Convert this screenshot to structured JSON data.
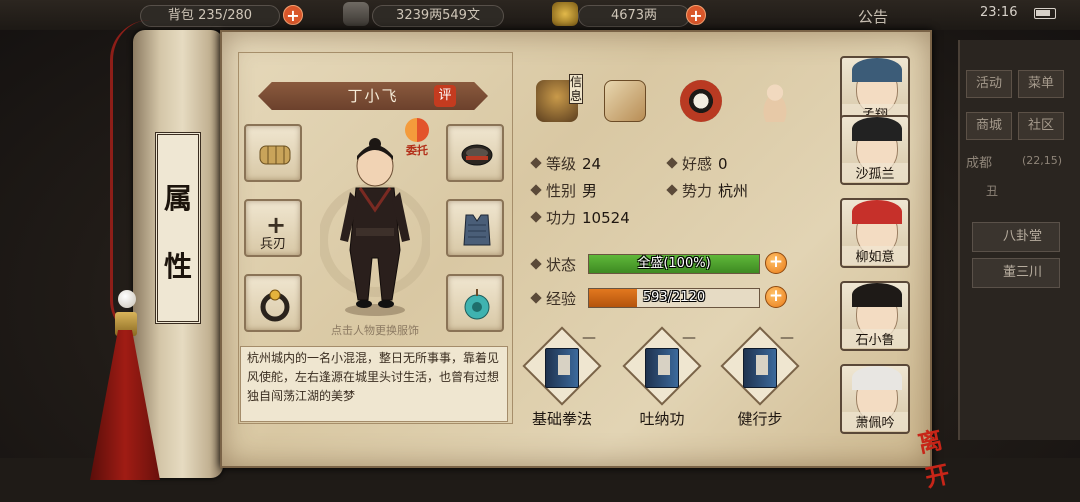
{
  "topbar": {
    "bag_label": "背包",
    "bag_value": "235/280",
    "money_value": "3239两549文",
    "gold_value": "4673两",
    "notice_label": "公告",
    "clock": "23:16"
  },
  "background_menu": {
    "buttons": [
      "活动",
      "菜单",
      "商城",
      "社区"
    ],
    "location": "成都",
    "coords": "(22,15)",
    "time_of_day": "丑",
    "tags": [
      "八卦堂",
      "董三川"
    ]
  },
  "scroll": {
    "chars": [
      "属",
      "性"
    ]
  },
  "character": {
    "name": "丁小飞",
    "rate_badge": "评",
    "entrust_label": "委托",
    "change_hint": "点击人物更换服饰",
    "weapon_slot_label": "兵刃",
    "bio": "杭州城内的一名小混混，整日无所事事，靠着见风使舵，左右逢源在城里头讨生活，也曾有过想独自闯荡江湖的美梦",
    "info_tab_label": "信息"
  },
  "stats": {
    "level_label": "等级",
    "level": "24",
    "favor_label": "好感",
    "favor": "0",
    "gender_label": "性别",
    "gender": "男",
    "faction_label": "势力",
    "faction": "杭州",
    "power_label": "功力",
    "power": "10524",
    "status_label": "状态",
    "status_text": "全盛(100%)",
    "status_fraction": 1.0,
    "exp_label": "经验",
    "exp_text": "593/2120",
    "exp_fraction": 0.28
  },
  "skills": [
    {
      "name": "基础拳法",
      "dash": "—"
    },
    {
      "name": "吐纳功",
      "dash": "—"
    },
    {
      "name": "健行步",
      "dash": "—"
    }
  ],
  "companions": [
    "孟翔",
    "沙孤兰",
    "柳如意",
    "石小鲁",
    "萧佩吟"
  ],
  "leave_label": "离开",
  "colors": {
    "status_bar": "#5fb83a",
    "exp_bar": "#e2781f",
    "accent_red": "#c43b1f"
  }
}
